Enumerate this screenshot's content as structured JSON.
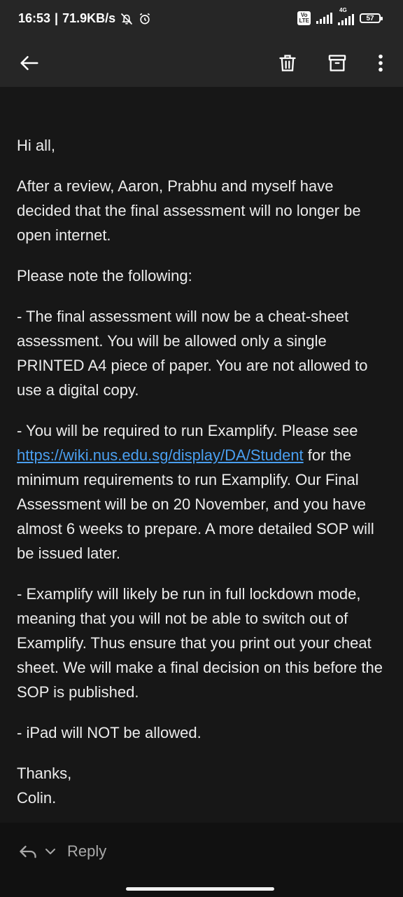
{
  "status_bar": {
    "time": "16:53",
    "separator": "|",
    "speed": "71.9KB/s",
    "volte_label": "Vo\nLTE",
    "network_label": "4G",
    "battery_level": "57",
    "icons": [
      "notifications-off-icon",
      "alarm-icon",
      "volte-icon",
      "signal-icon",
      "4g-signal-icon",
      "battery-icon"
    ]
  },
  "toolbar": {
    "icons": [
      "back-arrow-icon",
      "delete-icon",
      "archive-icon",
      "more-vert-icon"
    ]
  },
  "message": {
    "greeting": "Hi all,",
    "p1": "After a review, Aaron, Prabhu and myself have decided that the final assessment will no longer be open internet.",
    "p2": "Please note the following:",
    "p3": "- The final assessment will now be a cheat-sheet assessment. You will be allowed only a single PRINTED A4 piece of paper. You are not allowed to use a digital copy.",
    "p4_before": "- You will be required to run Examplify. Please see ",
    "p4_link": "https://wiki.nus.edu.sg/display/DA/Student",
    "p4_after": " for the minimum requirements to run Examplify. Our Final Assessment will be on 20 November, and you have almost 6 weeks to prepare. A more detailed SOP will be issued later.",
    "p5": "- Examplify will likely be run in full lockdown mode, meaning that you will not be able to switch out of Examplify. Thus ensure that you print out your cheat sheet. We will make a final decision on this before the SOP is published.",
    "p6": "- iPad will NOT be allowed.",
    "signoff": "Thanks,",
    "signature": "Colin."
  },
  "reply_bar": {
    "label": "Reply",
    "icons": [
      "reply-icon",
      "chevron-down-icon"
    ]
  },
  "colors": {
    "background": "#171717",
    "bar": "#262626",
    "text": "#ececec",
    "link": "#4a9ff0",
    "muted": "#a9a9a9"
  }
}
